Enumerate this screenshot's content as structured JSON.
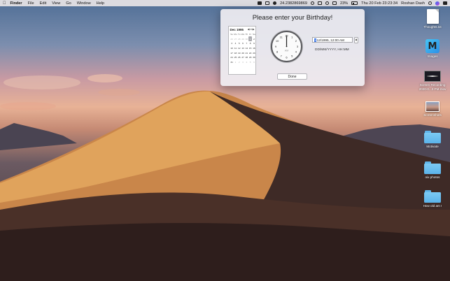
{
  "menubar": {
    "apple_icon": "apple-logo",
    "app_name": "Finder",
    "menus": [
      "File",
      "Edit",
      "View",
      "Go",
      "Window",
      "Help"
    ],
    "status_number": "24.2382869869",
    "battery": "23%",
    "datetime": "Thu 20 Feb  23:23:34",
    "user": "Roshan Dash"
  },
  "dialog": {
    "title": "Please enter your Birthday!",
    "calendar": {
      "month_label": "Dec 1995",
      "weekdays": [
        "Su",
        "Mo",
        "Tu",
        "We",
        "Th",
        "Fr",
        "Sa"
      ],
      "weeks": [
        [
          "26",
          "27",
          "28",
          "29",
          "30",
          "1",
          "2"
        ],
        [
          "3",
          "4",
          "5",
          "6",
          "7",
          "8",
          "9"
        ],
        [
          "10",
          "11",
          "12",
          "13",
          "14",
          "15",
          "16"
        ],
        [
          "17",
          "18",
          "19",
          "20",
          "21",
          "22",
          "23"
        ],
        [
          "24",
          "25",
          "26",
          "27",
          "28",
          "29",
          "30"
        ],
        [
          "31",
          "1",
          "2",
          "3",
          "4",
          "5",
          "6"
        ]
      ],
      "selected_day": "1"
    },
    "clock": {
      "period": "AM"
    },
    "datetime_field": {
      "highlight": "1",
      "value": "12/1995, 12:00 AM"
    },
    "format_hint": "DD/MM/YYYY, HH:MM",
    "done_label": "Done"
  },
  "desktop_icons": [
    {
      "label": "Thoughts.txt",
      "kind": "document"
    },
    {
      "label": "Images",
      "kind": "app"
    },
    {
      "label": "Screen Recording\n2020-0...3 PM.mov",
      "kind": "video"
    },
    {
      "label": "Screenshots",
      "kind": "screenshot"
    },
    {
      "label": "Motivate",
      "kind": "folder"
    },
    {
      "label": "oix photos",
      "kind": "folder"
    },
    {
      "label": "How old am I",
      "kind": "folder"
    }
  ],
  "colors": {
    "accent": "#2c6be6",
    "folder": "#6cc0f0",
    "dialog_bg": "#f0eef2"
  }
}
